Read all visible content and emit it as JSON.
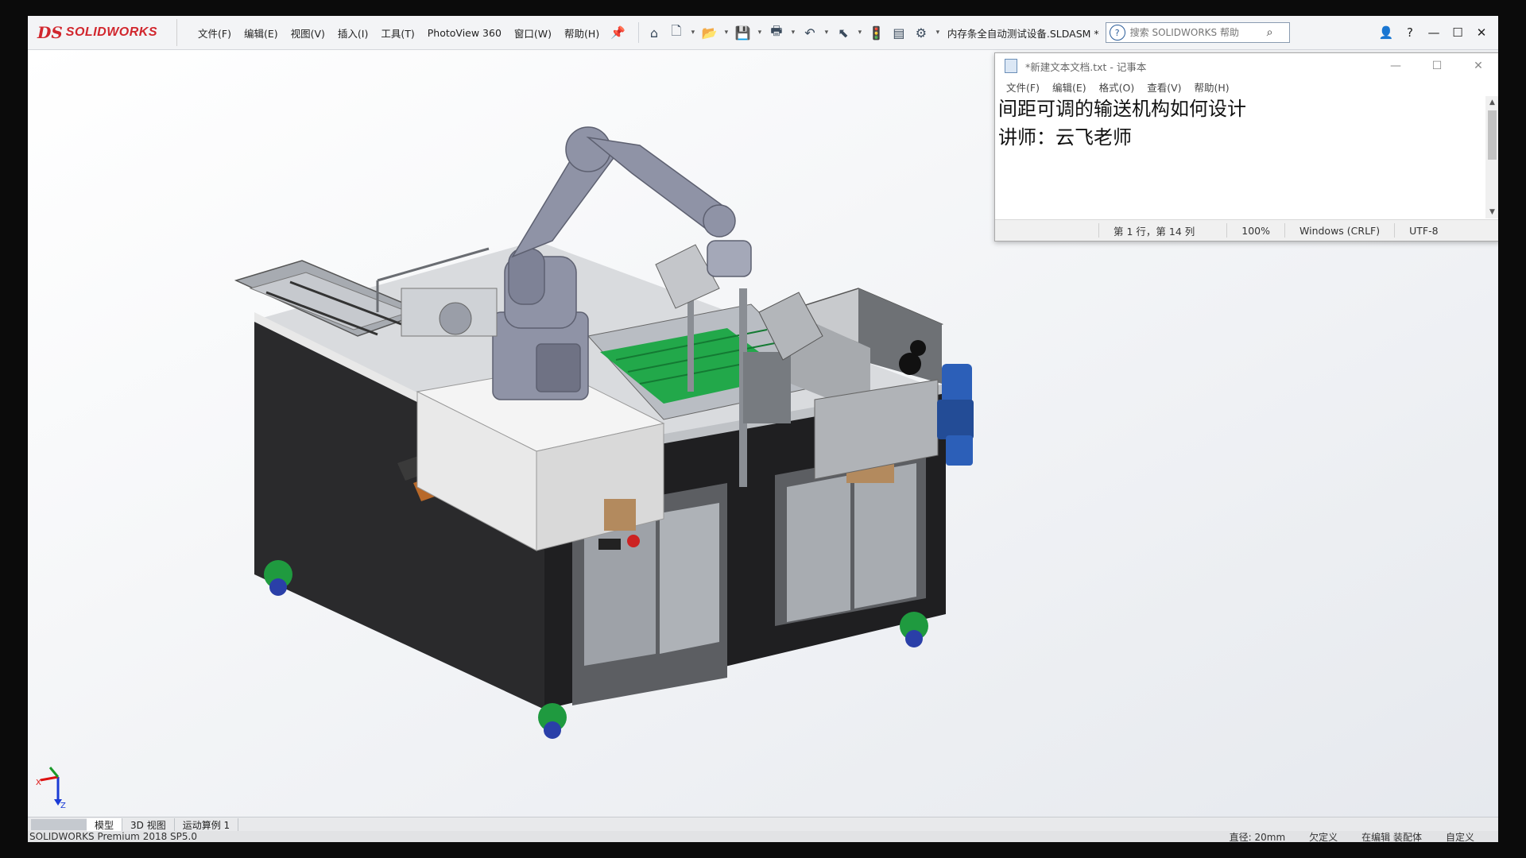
{
  "app": {
    "logo_mark": "DS",
    "logo_text": "SOLIDWORKS",
    "menu": [
      "文件(F)",
      "编辑(E)",
      "视图(V)",
      "插入(I)",
      "工具(T)",
      "PhotoView 360",
      "窗口(W)",
      "帮助(H)"
    ],
    "document_title": "内存条全自动测试设备.SLDASM *",
    "search_placeholder": "搜索 SOLIDWORKS 帮助"
  },
  "notepad": {
    "title": "*新建文本文档.txt - 记事本",
    "menu": [
      "文件(F)",
      "编辑(E)",
      "格式(O)",
      "查看(V)",
      "帮助(H)"
    ],
    "lines": [
      "间距可调的输送机构如何设计",
      "",
      "讲师：云飞老师"
    ],
    "status": {
      "position": "第 1 行，第 14 列",
      "zoom": "100%",
      "line_ending": "Windows (CRLF)",
      "encoding": "UTF-8"
    }
  },
  "tabs": [
    "模型",
    "3D 视图",
    "运动算例 1"
  ],
  "active_tab": "模型",
  "status_bar": {
    "left": "SOLIDWORKS Premium 2018 SP5.0",
    "items": [
      "直径: 20mm",
      "欠定义",
      "在编辑 装配体",
      "自定义"
    ]
  },
  "triad_labels": {
    "x": "X",
    "z": "Z"
  },
  "colors": {
    "brand_red": "#d1262d",
    "cabinet": "#2a2a2c",
    "robot": "#8f93a6",
    "tray_green": "#22a84a",
    "motor_blue": "#2c5fb8"
  }
}
